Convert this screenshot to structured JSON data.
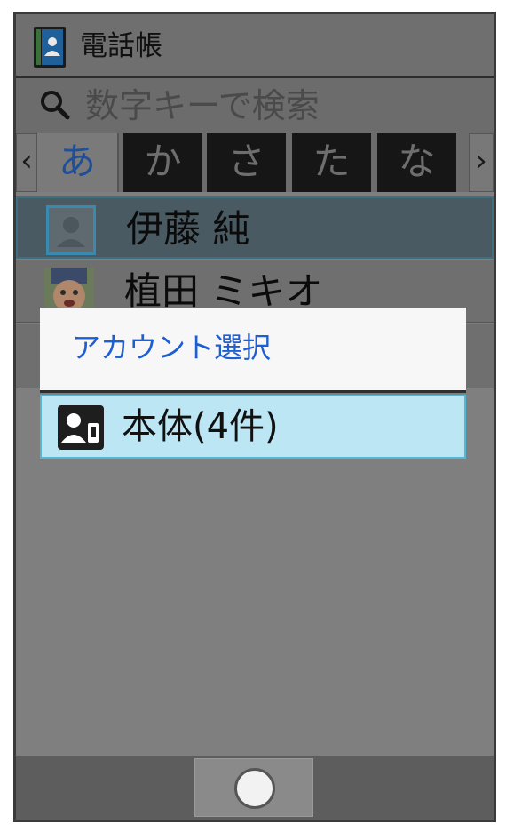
{
  "app": {
    "title": "電話帳",
    "icon": "contacts-book-icon"
  },
  "search": {
    "placeholder": "数字キーで検索",
    "icon": "search-icon"
  },
  "index_tabs": {
    "prev_arrow": "‹",
    "next_arrow": "›",
    "items": [
      {
        "label": "あ",
        "selected": true
      },
      {
        "label": "か",
        "selected": false
      },
      {
        "label": "さ",
        "selected": false
      },
      {
        "label": "た",
        "selected": false
      },
      {
        "label": "な",
        "selected": false
      }
    ]
  },
  "contacts": [
    {
      "name": "伊藤 純",
      "avatar": "default-person-icon",
      "highlighted": true
    },
    {
      "name": "植田 ミキオ",
      "avatar": "child-photo",
      "highlighted": false
    }
  ],
  "dialog": {
    "title": "アカウント選択",
    "items": [
      {
        "label": "本体(4件)",
        "icon": "phone-account-icon",
        "selected": true
      }
    ]
  },
  "navbar": {
    "home_icon": "home-circle-icon"
  },
  "colors": {
    "dialog_title": "#1d5fd0",
    "selected_item_bg": "#bde6f5",
    "selected_item_border": "#56b6d6",
    "selected_tab_text": "#1f4f9a"
  }
}
